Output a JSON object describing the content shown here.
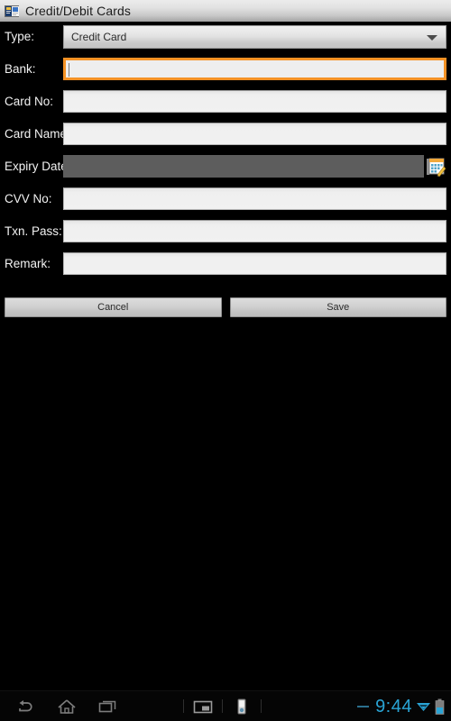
{
  "window": {
    "title": "Credit/Debit Cards",
    "icon": "cards-window-icon"
  },
  "form": {
    "fields": [
      {
        "label": "Type:",
        "value": "Credit Card",
        "kind": "dropdown",
        "name": "type"
      },
      {
        "label": "Bank:",
        "value": "",
        "kind": "text-focused",
        "name": "bank"
      },
      {
        "label": "Card No:",
        "value": "",
        "kind": "text",
        "name": "card-no"
      },
      {
        "label": "Card Name:",
        "value": "",
        "kind": "text",
        "name": "card-name"
      },
      {
        "label": "Expiry Date:",
        "value": "",
        "kind": "date",
        "name": "expiry-date"
      },
      {
        "label": "CVV No:",
        "value": "",
        "kind": "text",
        "name": "cvv-no"
      },
      {
        "label": "Txn. Pass:",
        "value": "",
        "kind": "text",
        "name": "txn-pass"
      },
      {
        "label": "Remark:",
        "value": "",
        "kind": "text",
        "name": "remark"
      }
    ],
    "calendar_icon": "calendar-picker-icon"
  },
  "buttons": {
    "cancel": "Cancel",
    "save": "Save"
  },
  "navbar": {
    "back_icon": "back-arrow-icon",
    "home_icon": "home-icon",
    "recents_icon": "recent-apps-icon",
    "screenshot_icon": "screen-capture-icon",
    "device_icon": "device-icon",
    "time": "9:44",
    "wifi_icon": "wifi-icon",
    "battery_icon": "battery-icon"
  },
  "colors": {
    "focus_orange": "#f59225",
    "accent_blue": "#2aa5d6",
    "disabled_gray": "#5d5d5d",
    "field_bg": "#f1f1f1",
    "window_bg": "#000000"
  }
}
